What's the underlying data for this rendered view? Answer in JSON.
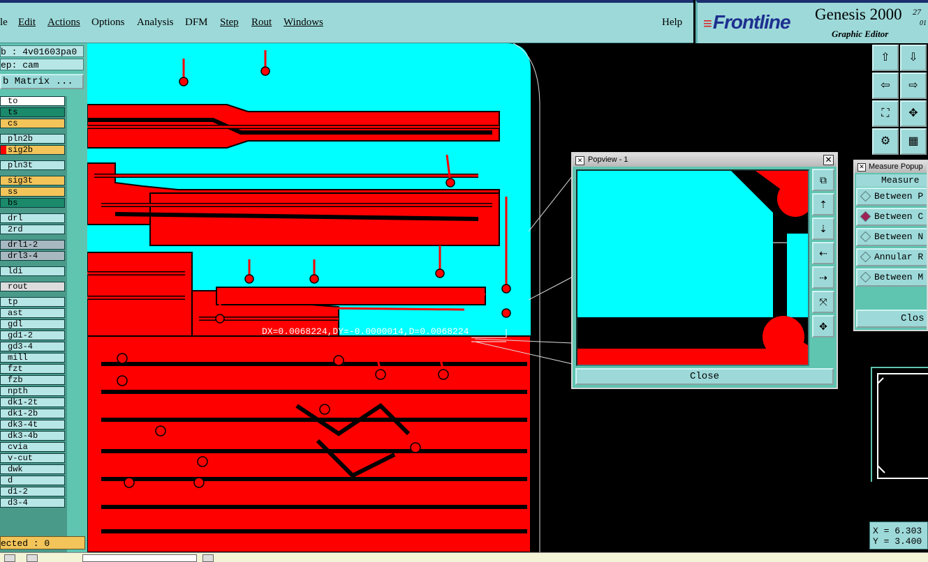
{
  "menubar": {
    "items": [
      "le",
      "Edit",
      "Actions",
      "Options",
      "Analysis",
      "DFM",
      "Step",
      "Rout",
      "Windows"
    ],
    "help": "Help"
  },
  "brand": {
    "logo": "Frontline",
    "product": "Genesis 2000",
    "version_a": "27",
    "version_b": "01",
    "subtitle": "Graphic Editor"
  },
  "left": {
    "job": "b : 4v01603pa0",
    "step": "ep: cam",
    "matrix_button": "b Matrix ...",
    "selected": "ected : 0",
    "layers": [
      {
        "name": "to",
        "color": "#ffffff"
      },
      {
        "name": "ts",
        "color": "#1a8a6a"
      },
      {
        "name": "cs",
        "color": "#f2c45a"
      },
      {
        "name": "pln2b",
        "color": "#b7e6e6"
      },
      {
        "name": "sig2b",
        "color": "#f2c45a",
        "mark": "#ff0000"
      },
      {
        "name": "pln3t",
        "color": "#b7e6e6"
      },
      {
        "name": "sig3t",
        "color": "#f2c45a"
      },
      {
        "name": "ss",
        "color": "#f2c45a"
      },
      {
        "name": "bs",
        "color": "#1a8a6a"
      },
      {
        "name": "drl",
        "color": "#b7e6e6"
      },
      {
        "name": "2rd",
        "color": "#b7e6e6"
      },
      {
        "name": "drl1-2",
        "color": "#a8b8c0"
      },
      {
        "name": "drl3-4",
        "color": "#a8b8c0"
      },
      {
        "name": "ldi",
        "color": "#b7e6e6"
      },
      {
        "name": "rout",
        "color": "#dcdcdc"
      },
      {
        "name": "tp",
        "color": "#b7e6e6"
      },
      {
        "name": "ast",
        "color": "#b7e6e6"
      },
      {
        "name": "gdl",
        "color": "#b7e6e6"
      },
      {
        "name": "gd1-2",
        "color": "#b7e6e6"
      },
      {
        "name": "gd3-4",
        "color": "#b7e6e6"
      },
      {
        "name": "mill",
        "color": "#b7e6e6"
      },
      {
        "name": "fzt",
        "color": "#b7e6e6"
      },
      {
        "name": "fzb",
        "color": "#b7e6e6"
      },
      {
        "name": "npth",
        "color": "#b7e6e6"
      },
      {
        "name": "dk1-2t",
        "color": "#b7e6e6"
      },
      {
        "name": "dk1-2b",
        "color": "#b7e6e6"
      },
      {
        "name": "dk3-4t",
        "color": "#b7e6e6"
      },
      {
        "name": "dk3-4b",
        "color": "#b7e6e6"
      },
      {
        "name": "cvia",
        "color": "#b7e6e6"
      },
      {
        "name": "v-cut",
        "color": "#b7e6e6"
      },
      {
        "name": "dwk",
        "color": "#b7e6e6"
      },
      {
        "name": "d",
        "color": "#b7e6e6"
      },
      {
        "name": "d1-2",
        "color": "#b7e6e6"
      },
      {
        "name": "d3-4",
        "color": "#b7e6e6"
      }
    ]
  },
  "canvas": {
    "measure_readout": "DX=0.0068224,DY=-0.0000014,D=0.0068224",
    "colors": {
      "copper": "#ff0000",
      "plane": "#00ffff",
      "trace_outline": "#000000"
    }
  },
  "popview": {
    "title": "Popview - 1",
    "close": "Close",
    "buttons": [
      "zoom-icon",
      "move-up-icon",
      "move-down-icon",
      "move-left-icon",
      "move-right-icon",
      "fit-icon",
      "center-icon"
    ]
  },
  "measure_popup": {
    "title": "Measure Popup",
    "header": "Measure",
    "options": [
      {
        "label": "Between P",
        "selected": false
      },
      {
        "label": "Between C",
        "selected": true
      },
      {
        "label": "Between N",
        "selected": false
      },
      {
        "label": "Annular R",
        "selected": false
      },
      {
        "label": "Between M",
        "selected": false
      }
    ],
    "close": "Clos"
  },
  "coords": {
    "x": "X = 6.303",
    "y": "Y = 3.400"
  }
}
